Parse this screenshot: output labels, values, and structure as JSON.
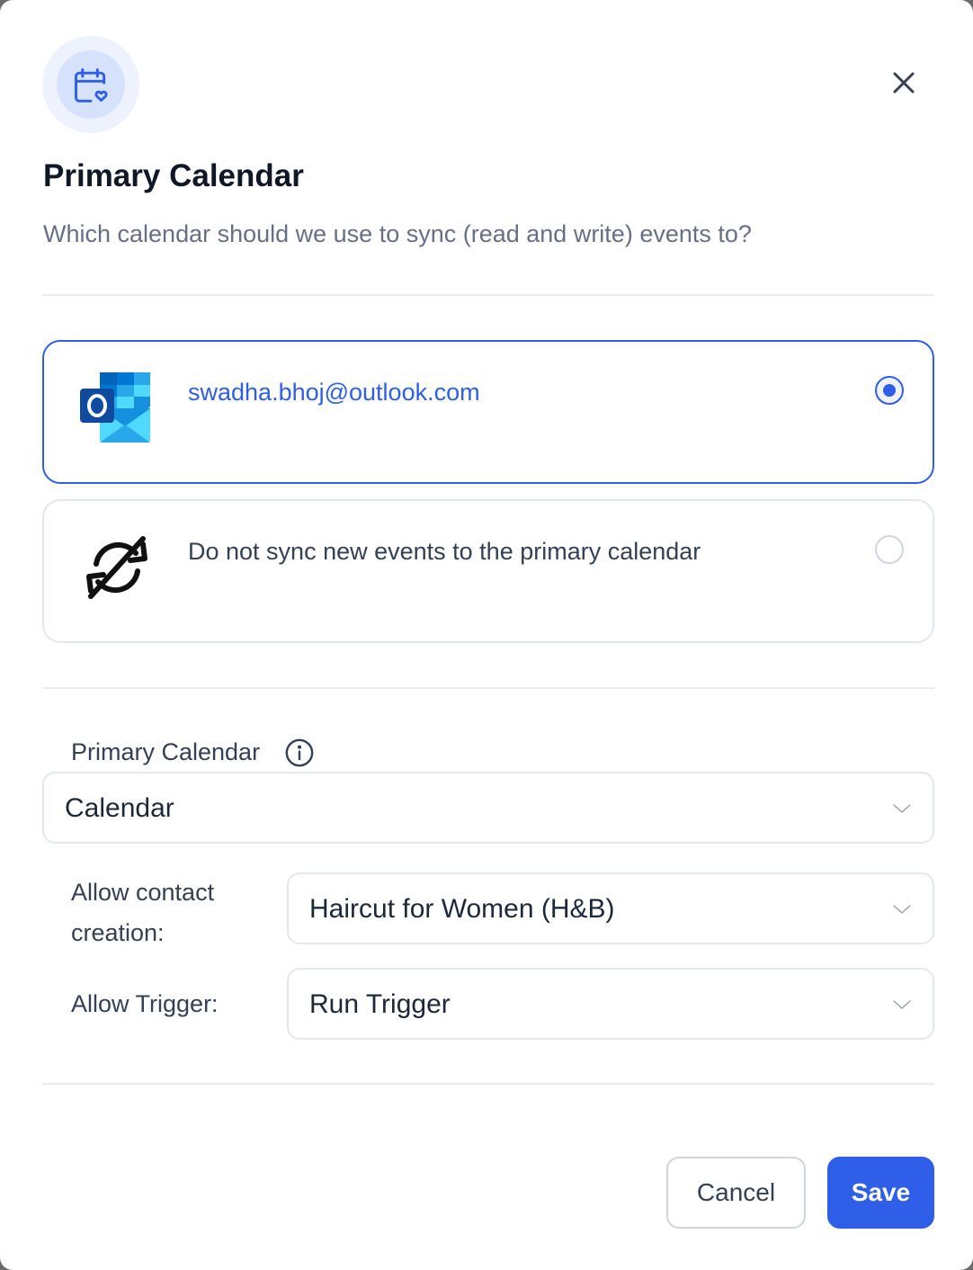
{
  "modal": {
    "title": "Primary Calendar",
    "subtitle": "Which calendar should we use to sync (read and write) events to?",
    "header_icon": "calendar-heart-icon",
    "close_icon": "close-icon"
  },
  "options": [
    {
      "label": "swadha.bhoj@outlook.com",
      "icon": "outlook-icon",
      "selected": true
    },
    {
      "label": "Do not sync new events to the primary calendar",
      "icon": "sync-off-icon",
      "selected": false
    }
  ],
  "fields": {
    "primary_calendar": {
      "label": "Primary Calendar",
      "value": "Calendar",
      "info_icon": "info-icon"
    },
    "contact_creation": {
      "label_line1": "Allow contact",
      "label_line2": "creation:",
      "value": "Haircut for Women (H&B)"
    },
    "trigger": {
      "label": "Allow Trigger:",
      "value": "Run Trigger"
    }
  },
  "footer": {
    "cancel_label": "Cancel",
    "save_label": "Save"
  },
  "colors": {
    "accent": "#2f5ee8",
    "title_text": "#101828",
    "muted_text": "#667085",
    "border": "#e4e7ec"
  }
}
